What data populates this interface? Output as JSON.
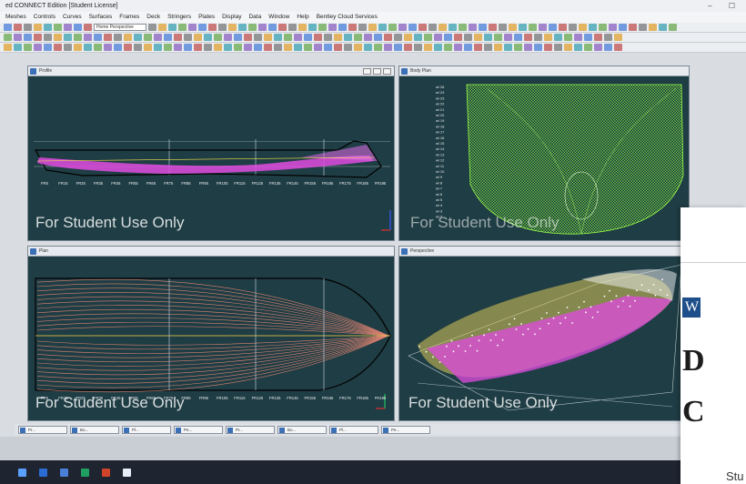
{
  "window": {
    "title": "ed CONNECT Edition [Student License]"
  },
  "menu": [
    "Meshes",
    "Controls",
    "Curves",
    "Surfaces",
    "Frames",
    "Deck",
    "Stringers",
    "Plates",
    "Display",
    "Data",
    "Window",
    "Help",
    "Bentley Cloud Services"
  ],
  "toolbar": {
    "view_combo": "Home Perspective"
  },
  "viewports": {
    "profile": {
      "title": "Profile",
      "watermark": "For Student Use Only",
      "frames": [
        "FR5",
        "FR15",
        "FR25",
        "FR35",
        "FR45",
        "FR55",
        "FR65",
        "FR75",
        "FR85",
        "FR95",
        "FR105",
        "FR115",
        "FR125",
        "FR135",
        "FR145",
        "FR155",
        "FR165",
        "FR175",
        "FR185",
        "FR195"
      ]
    },
    "body_plan": {
      "title": "Body Plan",
      "watermark": "For Student Use Only",
      "waterlines": [
        "wl 26",
        "wl 24",
        "wl 23",
        "wl 22",
        "wl 21",
        "wl 20",
        "wl 19",
        "wl 18",
        "wl 17",
        "wl 16",
        "wl 15",
        "wl 14",
        "wl 13",
        "wl 12",
        "wl 11",
        "wl 10",
        "wl 9",
        "wl 8",
        "wl 7",
        "wl 6",
        "wl 5",
        "wl 4",
        "wl 3",
        "wl 2"
      ]
    },
    "plan": {
      "title": "Plan",
      "watermark": "For Student Use Only",
      "frames": [
        "FR5",
        "FR15",
        "FR25",
        "FR35",
        "FR45",
        "FR55",
        "FR65",
        "FR75",
        "FR85",
        "FR95",
        "FR105",
        "FR115",
        "FR125",
        "FR135",
        "FR145",
        "FR155",
        "FR165",
        "FR175",
        "FR185",
        "FR195"
      ]
    },
    "perspective": {
      "title": "Perspective",
      "watermark": "For Student Use Only"
    }
  },
  "tabs": [
    "Pr...",
    "Bo...",
    "Pl...",
    "Pe...",
    "Pr...",
    "Bo...",
    "Pl...",
    "Pe..."
  ],
  "overlay": {
    "badge": "W",
    "line1": "D",
    "line2": "C",
    "small": "Stu"
  },
  "colors": {
    "viewport_bg": "#1f3d44",
    "hull_magenta": "#e04be0",
    "body_green": "#8dff3a",
    "plan_salmon": "#f08a76"
  }
}
